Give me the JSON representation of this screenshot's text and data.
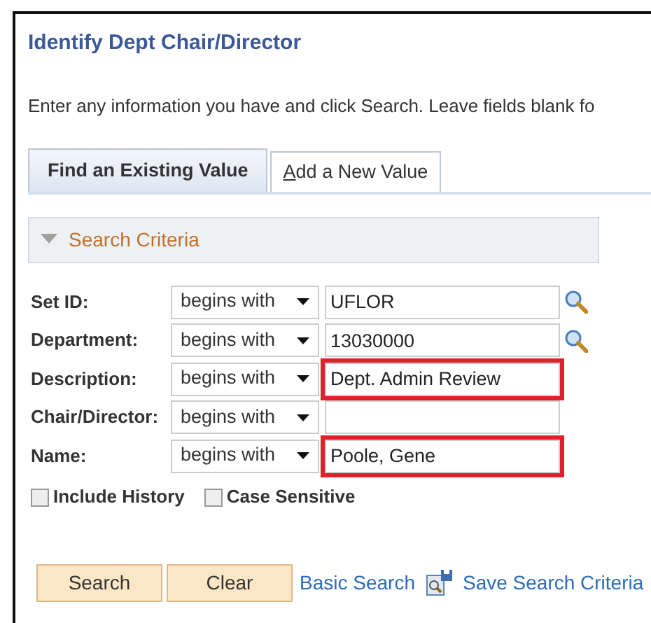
{
  "page": {
    "title": "Identify Dept Chair/Director",
    "instructions": "Enter any information you have and click Search. Leave fields blank fo"
  },
  "tabs": [
    {
      "label": "Find an Existing Value",
      "selected": true
    },
    {
      "label": "Add a New Value",
      "selected": false
    }
  ],
  "section": {
    "title": "Search Criteria",
    "expanded": true
  },
  "fields": [
    {
      "label": "Set ID:",
      "operator": "begins with",
      "value": "UFLOR",
      "lookup": true,
      "highlighted": false
    },
    {
      "label": "Department:",
      "operator": "begins with",
      "value": "13030000",
      "lookup": true,
      "highlighted": false
    },
    {
      "label": "Description:",
      "operator": "begins with",
      "value": "Dept. Admin Review",
      "lookup": false,
      "highlighted": true
    },
    {
      "label": "Chair/Director:",
      "operator": "begins with",
      "lookup": false,
      "highlighted": false
    },
    {
      "label": "Name:",
      "operator": "begins with",
      "value": "Poole, Gene",
      "lookup": false,
      "highlighted": true
    }
  ],
  "options": [
    {
      "label": "Include History",
      "checked": false
    },
    {
      "label": "Case Sensitive",
      "checked": false
    }
  ],
  "buttons": [
    "Search",
    "Clear"
  ],
  "links": [
    {
      "label": "Basic Search",
      "icon": false
    },
    {
      "label": "Save Search Criteria",
      "icon": true
    }
  ]
}
